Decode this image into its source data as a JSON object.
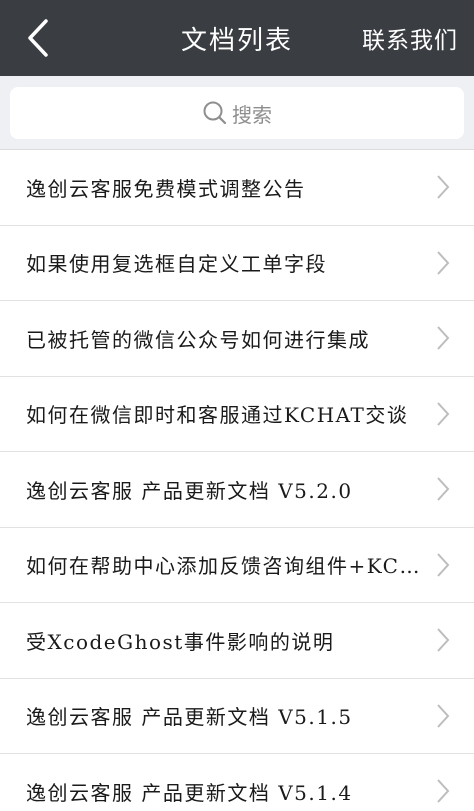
{
  "header": {
    "title": "文档列表",
    "contact_label": "联系我们",
    "back_icon": "chevron-left-icon"
  },
  "search": {
    "placeholder": "搜索",
    "icon": "search-icon"
  },
  "articles": [
    {
      "title": "逸创云客服免费模式调整公告"
    },
    {
      "title": "如果使用复选框自定义工单字段"
    },
    {
      "title": "已被托管的微信公众号如何进行集成"
    },
    {
      "title": "如何在微信即时和客服通过KCHAT交谈"
    },
    {
      "title": "逸创云客服 产品更新文档 V5.2.0"
    },
    {
      "title": "如何在帮助中心添加反馈咨询组件+KCHAT"
    },
    {
      "title": "受XcodeGhost事件影响的说明"
    },
    {
      "title": "逸创云客服 产品更新文档 V5.1.5"
    },
    {
      "title": "逸创云客服 产品更新文档 V5.1.4"
    }
  ],
  "colors": {
    "nav_bg": "#3a3d41",
    "search_bg": "#eff0f4",
    "chevron": "#bdbdbd"
  }
}
